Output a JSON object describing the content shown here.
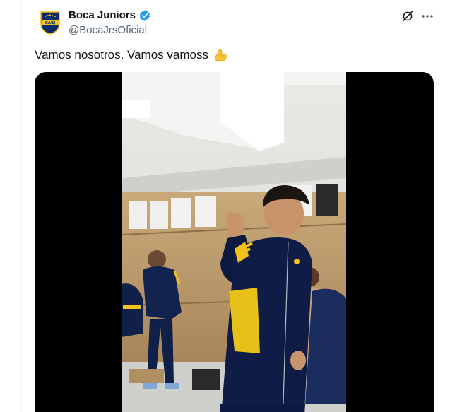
{
  "tweet": {
    "author": {
      "display_name": "Boca Juniors",
      "handle": "@BocaJrsOficial",
      "verified": true,
      "avatar_text": "CABJ"
    },
    "text": "Vamos nosotros. Vamos vamoss",
    "emoji": "flexed-biceps-emoji",
    "media": {
      "type": "video",
      "description_icon": "video-thumbnail"
    }
  },
  "actions": {
    "grok_icon": "grok-icon",
    "more_icon": "more-options-icon"
  },
  "colors": {
    "text_primary": "#0f1419",
    "text_secondary": "#536471",
    "verified_blue": "#1d9bf0",
    "boca_blue": "#0b2a6b",
    "boca_gold": "#f4c21b",
    "media_bg": "#000000"
  }
}
